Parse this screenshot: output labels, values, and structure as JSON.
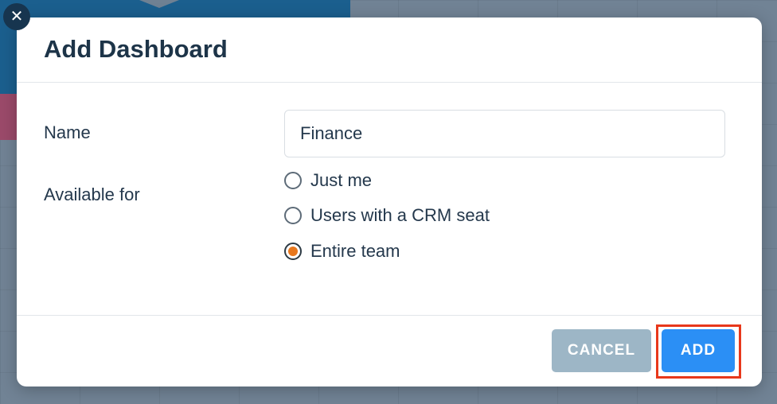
{
  "dialog": {
    "title": "Add Dashboard",
    "close_icon": "close-icon"
  },
  "form": {
    "name_label": "Name",
    "name_value": "Finance",
    "available_label": "Available for",
    "options": [
      {
        "label": "Just me",
        "selected": false
      },
      {
        "label": "Users with a CRM seat",
        "selected": false
      },
      {
        "label": "Entire team",
        "selected": true
      }
    ]
  },
  "footer": {
    "cancel_label": "CANCEL",
    "add_label": "ADD"
  },
  "colors": {
    "primary": "#2b8ff5",
    "cancel": "#9db6c6",
    "radio_selected": "#e8781e",
    "highlight": "#e8381b",
    "title": "#1d3448"
  }
}
